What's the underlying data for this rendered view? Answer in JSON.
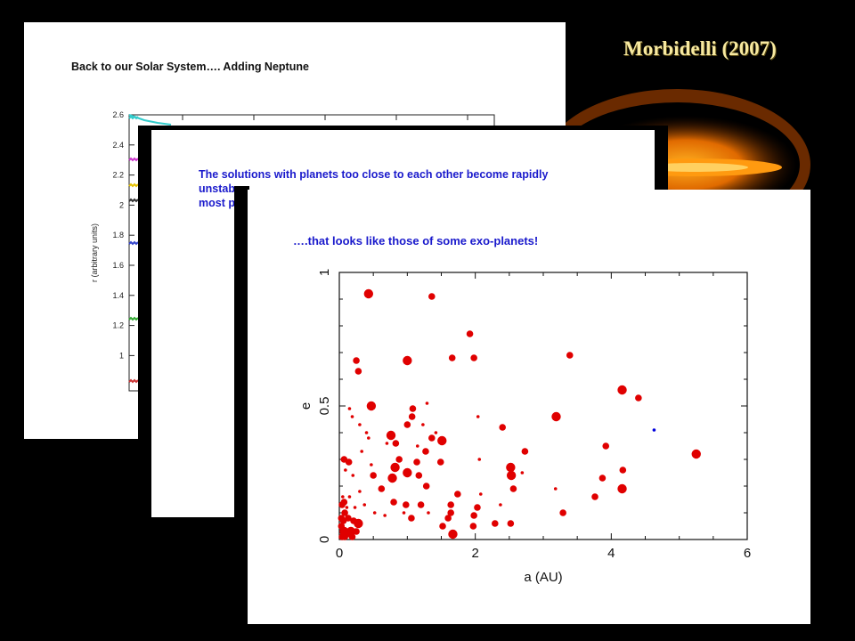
{
  "credit": "Morbidelli (2007)",
  "slide1": {
    "title": "Back to our Solar System…. Adding Neptune",
    "ylabel": "r (arbitrary units)",
    "yticks": [
      "2.6",
      "2.4",
      "2.2",
      "2",
      "1.8",
      "1.6",
      "1.4",
      "1.2",
      "1"
    ],
    "series_colors": [
      "#33cccc",
      "#cc33cc",
      "#e6c200",
      "#333333",
      "#3344cc",
      "#33aa33",
      "#cc3333"
    ]
  },
  "slide2": {
    "line1": "The solutions with planets too close to each other become rapidly",
    "line2": "unstab",
    "line3": "most p"
  },
  "slide3": {
    "title": "….that looks like those of some exo-planets!",
    "xlabel": "a (AU)",
    "ylabel": "e"
  },
  "colors": {
    "points": "#e00000",
    "highlight": "#0000dd",
    "title_blue": "#1a1acc"
  },
  "chart_data": {
    "type": "scatter",
    "title": "….that looks like those of some exo-planets!",
    "xlabel": "a (AU)",
    "ylabel": "e",
    "xlim": [
      0,
      6
    ],
    "ylim": [
      0,
      1
    ],
    "xticks": [
      0,
      2,
      4,
      6
    ],
    "yticks": [
      0,
      0.5,
      1
    ],
    "series": [
      {
        "color": "#e00000",
        "points": [
          [
            0.43,
            0.92,
            "L"
          ],
          [
            1.36,
            0.91,
            "M"
          ],
          [
            1.92,
            0.77,
            "M"
          ],
          [
            3.39,
            0.69,
            "M"
          ],
          [
            0.25,
            0.67,
            "M"
          ],
          [
            1.0,
            0.67,
            "L"
          ],
          [
            1.66,
            0.68,
            "M"
          ],
          [
            1.98,
            0.68,
            "M"
          ],
          [
            0.28,
            0.63,
            "M"
          ],
          [
            4.16,
            0.56,
            "L"
          ],
          [
            4.4,
            0.53,
            "M"
          ],
          [
            0.47,
            0.5,
            "L"
          ],
          [
            1.08,
            0.49,
            "M"
          ],
          [
            1.29,
            0.51,
            "S"
          ],
          [
            1.07,
            0.46,
            "M"
          ],
          [
            1.0,
            0.43,
            "M"
          ],
          [
            2.04,
            0.46,
            "S"
          ],
          [
            3.19,
            0.46,
            "L"
          ],
          [
            0.15,
            0.49,
            "S"
          ],
          [
            0.19,
            0.46,
            "S"
          ],
          [
            0.3,
            0.43,
            "S"
          ],
          [
            0.4,
            0.4,
            "S"
          ],
          [
            0.76,
            0.39,
            "L"
          ],
          [
            1.23,
            0.43,
            "S"
          ],
          [
            1.42,
            0.4,
            "S"
          ],
          [
            1.36,
            0.38,
            "M"
          ],
          [
            1.51,
            0.37,
            "L"
          ],
          [
            2.4,
            0.42,
            "M"
          ],
          [
            0.83,
            0.36,
            "M"
          ],
          [
            0.7,
            0.36,
            "S"
          ],
          [
            0.88,
            0.3,
            "M"
          ],
          [
            0.43,
            0.38,
            "S"
          ],
          [
            0.33,
            0.33,
            "S"
          ],
          [
            1.15,
            0.35,
            "S"
          ],
          [
            1.27,
            0.33,
            "M"
          ],
          [
            3.92,
            0.35,
            "M"
          ],
          [
            2.73,
            0.33,
            "M"
          ],
          [
            5.25,
            0.32,
            "L"
          ],
          [
            0.07,
            0.3,
            "M"
          ],
          [
            0.14,
            0.29,
            "M"
          ],
          [
            0.47,
            0.28,
            "S"
          ],
          [
            0.82,
            0.27,
            "L"
          ],
          [
            1.0,
            0.25,
            "L"
          ],
          [
            1.14,
            0.29,
            "M"
          ],
          [
            1.49,
            0.29,
            "M"
          ],
          [
            2.06,
            0.3,
            "S"
          ],
          [
            2.52,
            0.27,
            "L"
          ],
          [
            4.17,
            0.26,
            "M"
          ],
          [
            0.09,
            0.26,
            "S"
          ],
          [
            0.2,
            0.24,
            "S"
          ],
          [
            0.5,
            0.24,
            "M"
          ],
          [
            0.78,
            0.23,
            "L"
          ],
          [
            1.17,
            0.24,
            "M"
          ],
          [
            2.69,
            0.25,
            "S"
          ],
          [
            2.53,
            0.24,
            "L"
          ],
          [
            3.87,
            0.23,
            "M"
          ],
          [
            0.62,
            0.19,
            "M"
          ],
          [
            1.28,
            0.2,
            "M"
          ],
          [
            2.56,
            0.19,
            "M"
          ],
          [
            3.18,
            0.19,
            "S"
          ],
          [
            4.16,
            0.19,
            "L"
          ],
          [
            0.3,
            0.18,
            "S"
          ],
          [
            0.15,
            0.16,
            "S"
          ],
          [
            0.05,
            0.16,
            "S"
          ],
          [
            0.04,
            0.13,
            "M"
          ],
          [
            0.07,
            0.14,
            "M"
          ],
          [
            1.74,
            0.17,
            "M"
          ],
          [
            2.08,
            0.17,
            "S"
          ],
          [
            3.76,
            0.16,
            "M"
          ],
          [
            0.11,
            0.12,
            "S"
          ],
          [
            0.23,
            0.12,
            "S"
          ],
          [
            0.37,
            0.13,
            "S"
          ],
          [
            0.8,
            0.14,
            "M"
          ],
          [
            0.98,
            0.13,
            "M"
          ],
          [
            1.2,
            0.13,
            "M"
          ],
          [
            1.64,
            0.13,
            "M"
          ],
          [
            2.03,
            0.12,
            "M"
          ],
          [
            2.37,
            0.13,
            "S"
          ],
          [
            0.08,
            0.1,
            "M"
          ],
          [
            0.52,
            0.1,
            "S"
          ],
          [
            0.95,
            0.1,
            "S"
          ],
          [
            1.31,
            0.1,
            "S"
          ],
          [
            1.64,
            0.1,
            "M"
          ],
          [
            1.98,
            0.09,
            "M"
          ],
          [
            0.67,
            0.09,
            "S"
          ],
          [
            3.29,
            0.1,
            "M"
          ],
          [
            0.03,
            0.08,
            "M"
          ],
          [
            0.06,
            0.07,
            "M"
          ],
          [
            0.13,
            0.08,
            "M"
          ],
          [
            0.21,
            0.07,
            "M"
          ],
          [
            1.06,
            0.08,
            "M"
          ],
          [
            1.6,
            0.08,
            "M"
          ],
          [
            0.28,
            0.06,
            "L"
          ],
          [
            0.03,
            0.05,
            "M"
          ],
          [
            1.52,
            0.05,
            "M"
          ],
          [
            2.29,
            0.06,
            "M"
          ],
          [
            1.97,
            0.05,
            "M"
          ],
          [
            2.52,
            0.06,
            "M"
          ],
          [
            0.07,
            0.03,
            "L"
          ],
          [
            0.17,
            0.03,
            "L"
          ],
          [
            0.25,
            0.03,
            "M"
          ],
          [
            1.67,
            0.02,
            "L"
          ],
          [
            0.04,
            0.01,
            "M"
          ],
          [
            0.08,
            0.01,
            "M"
          ],
          [
            0.12,
            0.02,
            "M"
          ],
          [
            0.19,
            0.01,
            "M"
          ]
        ]
      },
      {
        "color": "#0000dd",
        "points": [
          [
            4.63,
            0.41,
            "S"
          ]
        ]
      }
    ]
  }
}
